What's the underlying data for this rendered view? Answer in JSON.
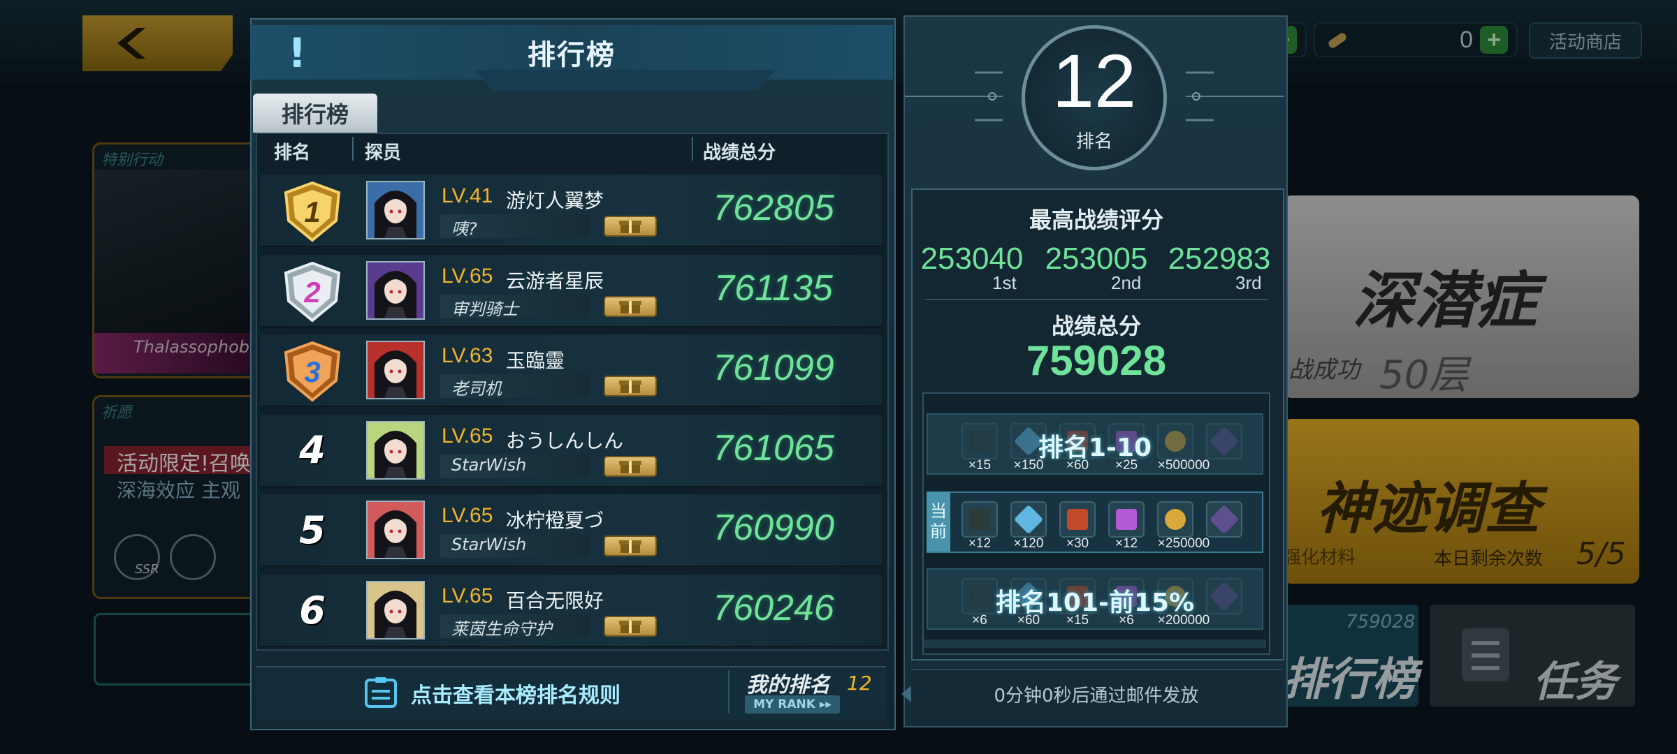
{
  "background": {
    "topbar_count": "0",
    "shop_label": "活动商店",
    "left_cards": [
      {
        "tag": "特别行动",
        "caption": "Thalassophob"
      },
      {
        "tag": "祈愿",
        "line1": "活动限定!召唤",
        "line2": "深海效应  主观",
        "ssr": "SSR"
      }
    ],
    "right_cards": [
      {
        "title": "深潜症",
        "status": "战成功",
        "floor": "50层"
      },
      {
        "title": "神迹调查",
        "sub": "强化材料",
        "remain_label": "本日剩余次数",
        "remain_value": "5/5"
      }
    ],
    "bottom_tiles": [
      {
        "label": "排行榜",
        "score": "759028"
      },
      {
        "label": "任务"
      }
    ]
  },
  "panel": {
    "title": "排行榜",
    "tab": "排行榜",
    "columns": {
      "rank": "排名",
      "member": "探员",
      "score": "战绩总分"
    },
    "rows": [
      {
        "rank": "1",
        "level": "LV.41",
        "name": "游灯人翼梦",
        "title": "咦?",
        "score": "762805",
        "badge": "gold",
        "avatar_bg": "#3b6ea8"
      },
      {
        "rank": "2",
        "level": "LV.65",
        "name": "云游者星辰",
        "title": "审判骑士",
        "score": "761135",
        "badge": "silver",
        "avatar_bg": "#5a3c8e"
      },
      {
        "rank": "3",
        "level": "LV.63",
        "name": "玉臨靈",
        "title": "老司机",
        "score": "761099",
        "badge": "bronze",
        "avatar_bg": "#b8302c"
      },
      {
        "rank": "4",
        "level": "LV.65",
        "name": "おうしんしん",
        "title": "StarWish",
        "score": "761065",
        "badge": "",
        "avatar_bg": "#b9d67e"
      },
      {
        "rank": "5",
        "level": "LV.65",
        "name": "冰柠橙夏づ",
        "title": "StarWish",
        "score": "760990",
        "badge": "",
        "avatar_bg": "#d25a5a"
      },
      {
        "rank": "6",
        "level": "LV.65",
        "name": "百合无限好",
        "title": "莱茵生命守护",
        "score": "760246",
        "badge": "",
        "avatar_bg": "#d9c48a"
      }
    ],
    "rules_link": "点击查看本榜排名规则",
    "my_rank_label": "我的排名",
    "my_rank_value": "12",
    "my_rank_sub": "MY RANK ▸▸"
  },
  "side": {
    "rank": "12",
    "rank_caption": "排名",
    "best_title": "最高战绩评分",
    "best_scores": [
      {
        "value": "253040",
        "ordinal": "1st"
      },
      {
        "value": "253005",
        "ordinal": "2nd"
      },
      {
        "value": "252983",
        "ordinal": "3rd"
      }
    ],
    "total_label": "战绩总分",
    "total_value": "759028",
    "tiers": [
      {
        "label": "排名1-10",
        "qty": [
          "×15",
          "×150",
          "×60",
          "×25",
          "×500000",
          ""
        ]
      },
      {
        "label": "",
        "current_tag": "当前",
        "qty": [
          "×12",
          "×120",
          "×30",
          "×12",
          "×250000",
          ""
        ]
      },
      {
        "label": "排名101-前15%",
        "qty": [
          "×6",
          "×60",
          "×15",
          "×6",
          "×200000",
          ""
        ]
      }
    ],
    "mail_note": "0分钟0秒后通过邮件发放"
  },
  "colors": {
    "score_green": "#6fe39a",
    "level_gold": "#f2b52b",
    "accent_cyan": "#a9ecff"
  }
}
